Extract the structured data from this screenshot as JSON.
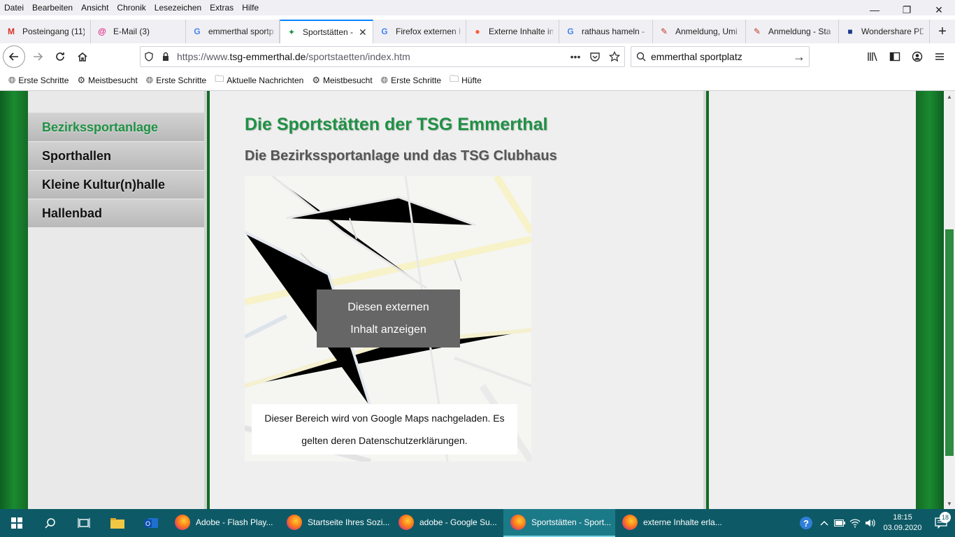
{
  "menubar": {
    "items": [
      "Datei",
      "Bearbeiten",
      "Ansicht",
      "Chronik",
      "Lesezeichen",
      "Extras",
      "Hilfe"
    ]
  },
  "window": {
    "minimize": "—",
    "restore": "❐",
    "close": "✕"
  },
  "tabs": [
    {
      "label": "Posteingang (11)",
      "icon": "M",
      "icon_color": "#d93025"
    },
    {
      "label": "E-Mail (3)",
      "icon": "@",
      "icon_color": "#e0237f"
    },
    {
      "label": "emmerthal sportp",
      "icon": "G",
      "icon_color": "#4285f4"
    },
    {
      "label": "Sportstätten -",
      "icon": "✦",
      "icon_color": "#1f9145"
    },
    {
      "label": "Firefox externen I",
      "icon": "G",
      "icon_color": "#4285f4"
    },
    {
      "label": "Externe Inhalte in",
      "icon": "●",
      "icon_color": "#ff5a36"
    },
    {
      "label": "rathaus hameln -",
      "icon": "G",
      "icon_color": "#4285f4"
    },
    {
      "label": "Anmeldung, Umi",
      "icon": "✎",
      "icon_color": "#c0392b"
    },
    {
      "label": "Anmeldung - Sta",
      "icon": "✎",
      "icon_color": "#c0392b"
    },
    {
      "label": "Wondershare PDI",
      "icon": "■",
      "icon_color": "#1a3a8a"
    }
  ],
  "tab_close": "✕",
  "new_tab": "+",
  "nav": {
    "url_prefix": "https://www.",
    "url_host": "tsg-emmerthal.de",
    "url_path": "/sportstaetten/index.htm",
    "search_value": "emmerthal sportplatz",
    "more": "•••",
    "go": "→"
  },
  "bookmarks": [
    {
      "label": "Erste Schritte",
      "icon": "globe"
    },
    {
      "label": "Meistbesucht",
      "icon": "gear"
    },
    {
      "label": "Erste Schritte",
      "icon": "globe"
    },
    {
      "label": "Aktuelle Nachrichten",
      "icon": "folder"
    },
    {
      "label": "Meistbesucht",
      "icon": "gear"
    },
    {
      "label": "Erste Schritte",
      "icon": "globe"
    },
    {
      "label": "Hüfte",
      "icon": "folder"
    }
  ],
  "sidebar": {
    "items": [
      {
        "label": "Bezirkssportanlage",
        "active": true
      },
      {
        "label": "Sporthallen",
        "active": false
      },
      {
        "label": "Kleine Kultur(n)halle",
        "active": false
      },
      {
        "label": "Hallenbad",
        "active": false
      }
    ]
  },
  "main": {
    "title": "Die Sportstätten der TSG Emmerthal",
    "subtitle": "Die Bezirkssportanlage und das TSG Clubhaus",
    "map_button_line1": "Diesen externen",
    "map_button_line2": "Inhalt anzeigen",
    "map_notice_line1": "Dieser Bereich wird von Google Maps nachgeladen. Es",
    "map_notice_line2": "gelten deren Datenschutzerklärungen."
  },
  "taskbar": {
    "apps": [
      {
        "label": "Adobe - Flash Play...",
        "active": false
      },
      {
        "label": "Startseite Ihres Sozi...",
        "active": false
      },
      {
        "label": "adobe - Google Su...",
        "active": false
      },
      {
        "label": "Sportstätten - Sport...",
        "active": true
      },
      {
        "label": "externe Inhalte erla...",
        "active": false
      }
    ],
    "time": "18:15",
    "date": "03.09.2020",
    "notifications": "18"
  },
  "colors": {
    "accent_green": "#1f9145",
    "firefox_blue": "#0a84ff",
    "taskbar": "#0d5a66"
  }
}
